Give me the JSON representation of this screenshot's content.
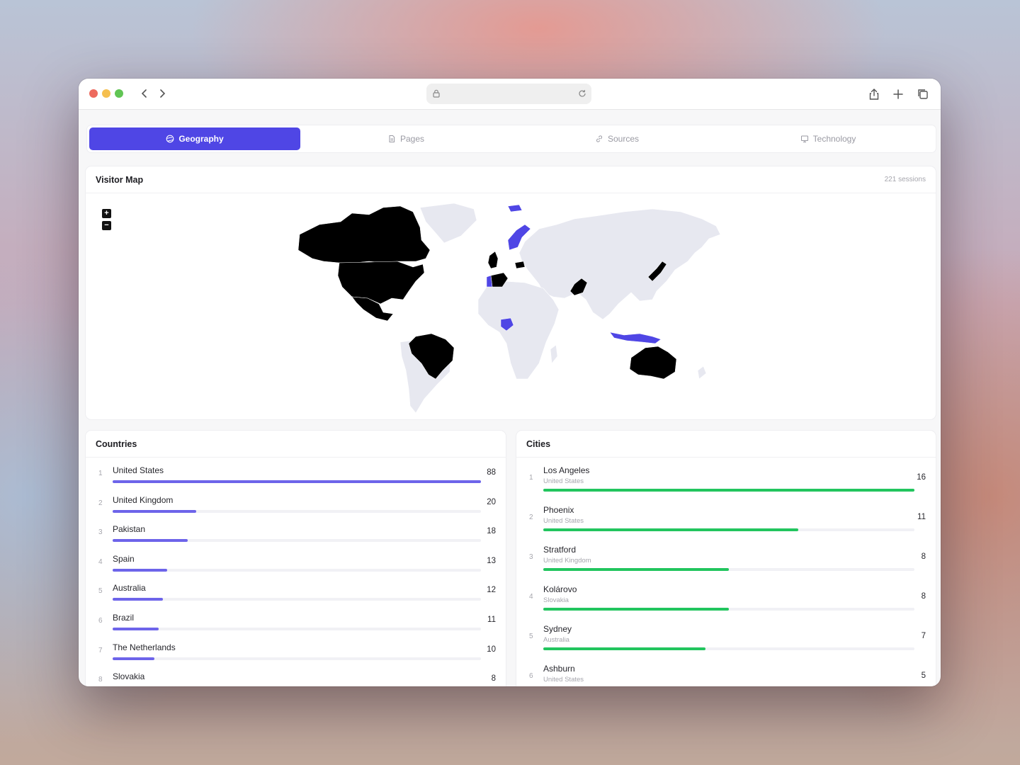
{
  "colors": {
    "accent": "#4f46e5",
    "country_bar": "#6d64ea",
    "city_bar": "#22c55e",
    "map_visited_dark": "#000000",
    "map_visited_accent": "#4f46e5",
    "map_land": "#e7e8f0"
  },
  "browser": {
    "back_icon": "chevron-left-icon",
    "forward_icon": "chevron-right-icon",
    "url": "",
    "share_icon": "share-icon",
    "new_tab_icon": "plus-icon",
    "tabs_icon": "tabs-icon"
  },
  "tabs": [
    {
      "label": "Geography",
      "icon": "globe-icon",
      "active": true
    },
    {
      "label": "Pages",
      "icon": "file-icon",
      "active": false
    },
    {
      "label": "Sources",
      "icon": "link-icon",
      "active": false
    },
    {
      "label": "Technology",
      "icon": "monitor-icon",
      "active": false
    }
  ],
  "map": {
    "title": "Visitor Map",
    "sessions": "221 sessions",
    "zoom_in": "+",
    "zoom_out": "−"
  },
  "countries": {
    "title": "Countries",
    "max": 88,
    "items": [
      {
        "rank": "1",
        "name": "United States",
        "value": 88
      },
      {
        "rank": "2",
        "name": "United Kingdom",
        "value": 20
      },
      {
        "rank": "3",
        "name": "Pakistan",
        "value": 18
      },
      {
        "rank": "4",
        "name": "Spain",
        "value": 13
      },
      {
        "rank": "5",
        "name": "Australia",
        "value": 12
      },
      {
        "rank": "6",
        "name": "Brazil",
        "value": 11
      },
      {
        "rank": "7",
        "name": "The Netherlands",
        "value": 10
      },
      {
        "rank": "8",
        "name": "Slovakia",
        "value": 8
      }
    ]
  },
  "cities": {
    "title": "Cities",
    "max": 16,
    "items": [
      {
        "rank": "1",
        "name": "Los Angeles",
        "country": "United States",
        "value": 16
      },
      {
        "rank": "2",
        "name": "Phoenix",
        "country": "United States",
        "value": 11
      },
      {
        "rank": "3",
        "name": "Stratford",
        "country": "United Kingdom",
        "value": 8
      },
      {
        "rank": "4",
        "name": "Kolárovo",
        "country": "Slovakia",
        "value": 8
      },
      {
        "rank": "5",
        "name": "Sydney",
        "country": "Australia",
        "value": 7
      },
      {
        "rank": "6",
        "name": "Ashburn",
        "country": "United States",
        "value": 5
      }
    ]
  }
}
